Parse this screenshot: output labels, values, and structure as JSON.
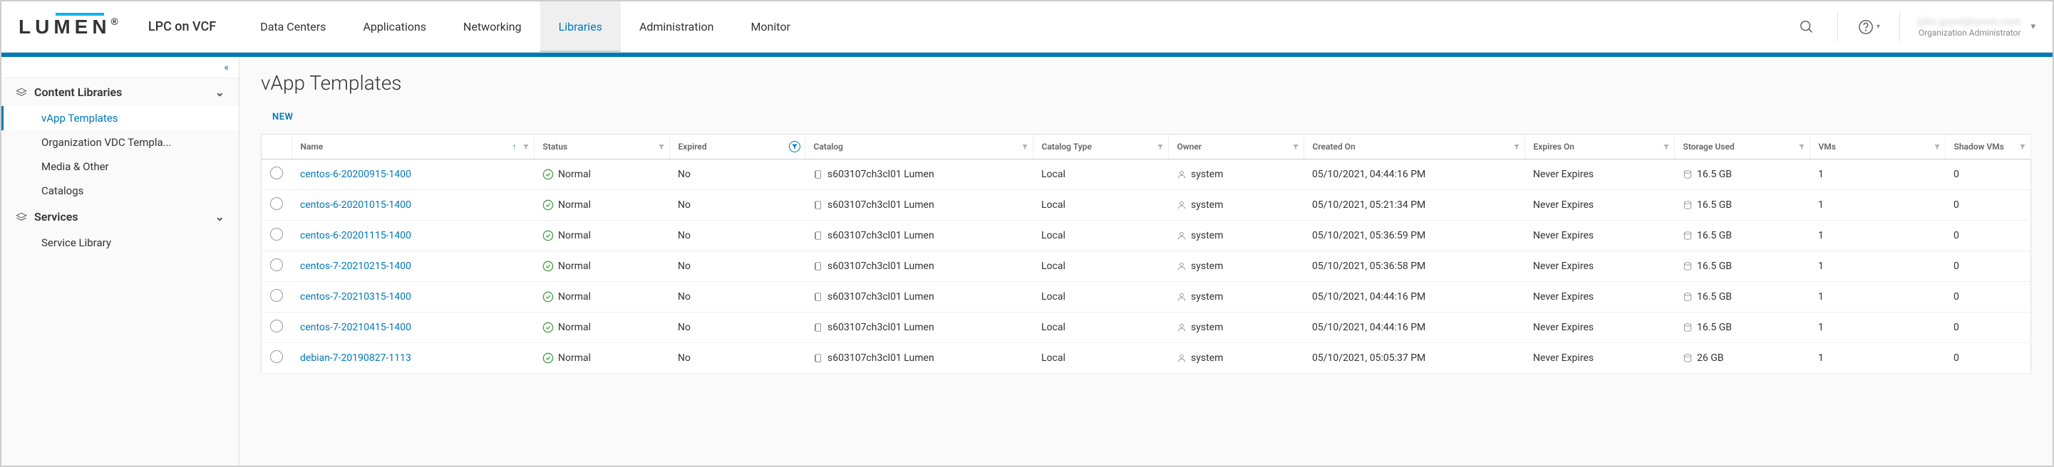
{
  "brand": {
    "logo_text": "LUMEN",
    "site": "LPC on VCF"
  },
  "nav": {
    "items": [
      "Data Centers",
      "Applications",
      "Networking",
      "Libraries",
      "Administration",
      "Monitor"
    ],
    "active_index": 3
  },
  "user": {
    "email": "john.grant@lumen.com",
    "role": "Organization Administrator"
  },
  "sidebar": {
    "sections": [
      {
        "label": "Content Libraries",
        "icon": "stack",
        "expanded": true,
        "items": [
          "vApp Templates",
          "Organization VDC Templa...",
          "Media & Other",
          "Catalogs"
        ],
        "active_item": 0
      },
      {
        "label": "Services",
        "icon": "stack",
        "expanded": true,
        "items": [
          "Service Library"
        ]
      }
    ]
  },
  "page": {
    "title": "vApp Templates",
    "new_button": "NEW"
  },
  "table": {
    "columns": [
      "",
      "Name",
      "Status",
      "Expired",
      "Catalog",
      "Catalog Type",
      "Owner",
      "Created On",
      "Expires On",
      "Storage Used",
      "VMs",
      "Shadow VMs"
    ],
    "sort_col": 1,
    "filter_active_col": 3,
    "rows": [
      {
        "name": "centos-6-20200915-1400",
        "status": "Normal",
        "expired": "No",
        "catalog": "s603107ch3cl01 Lumen",
        "catalog_type": "Local",
        "owner": "system",
        "created": "05/10/2021, 04:44:16 PM",
        "expires": "Never Expires",
        "storage": "16.5 GB",
        "vms": "1",
        "shadow": "0"
      },
      {
        "name": "centos-6-20201015-1400",
        "status": "Normal",
        "expired": "No",
        "catalog": "s603107ch3cl01 Lumen",
        "catalog_type": "Local",
        "owner": "system",
        "created": "05/10/2021, 05:21:34 PM",
        "expires": "Never Expires",
        "storage": "16.5 GB",
        "vms": "1",
        "shadow": "0"
      },
      {
        "name": "centos-6-20201115-1400",
        "status": "Normal",
        "expired": "No",
        "catalog": "s603107ch3cl01 Lumen",
        "catalog_type": "Local",
        "owner": "system",
        "created": "05/10/2021, 05:36:59 PM",
        "expires": "Never Expires",
        "storage": "16.5 GB",
        "vms": "1",
        "shadow": "0"
      },
      {
        "name": "centos-7-20210215-1400",
        "status": "Normal",
        "expired": "No",
        "catalog": "s603107ch3cl01 Lumen",
        "catalog_type": "Local",
        "owner": "system",
        "created": "05/10/2021, 05:36:58 PM",
        "expires": "Never Expires",
        "storage": "16.5 GB",
        "vms": "1",
        "shadow": "0"
      },
      {
        "name": "centos-7-20210315-1400",
        "status": "Normal",
        "expired": "No",
        "catalog": "s603107ch3cl01 Lumen",
        "catalog_type": "Local",
        "owner": "system",
        "created": "05/10/2021, 04:44:16 PM",
        "expires": "Never Expires",
        "storage": "16.5 GB",
        "vms": "1",
        "shadow": "0"
      },
      {
        "name": "centos-7-20210415-1400",
        "status": "Normal",
        "expired": "No",
        "catalog": "s603107ch3cl01 Lumen",
        "catalog_type": "Local",
        "owner": "system",
        "created": "05/10/2021, 04:44:16 PM",
        "expires": "Never Expires",
        "storage": "16.5 GB",
        "vms": "1",
        "shadow": "0"
      },
      {
        "name": "debian-7-20190827-1113",
        "status": "Normal",
        "expired": "No",
        "catalog": "s603107ch3cl01 Lumen",
        "catalog_type": "Local",
        "owner": "system",
        "created": "05/10/2021, 05:05:37 PM",
        "expires": "Never Expires",
        "storage": "26 GB",
        "vms": "1",
        "shadow": "0"
      }
    ]
  }
}
